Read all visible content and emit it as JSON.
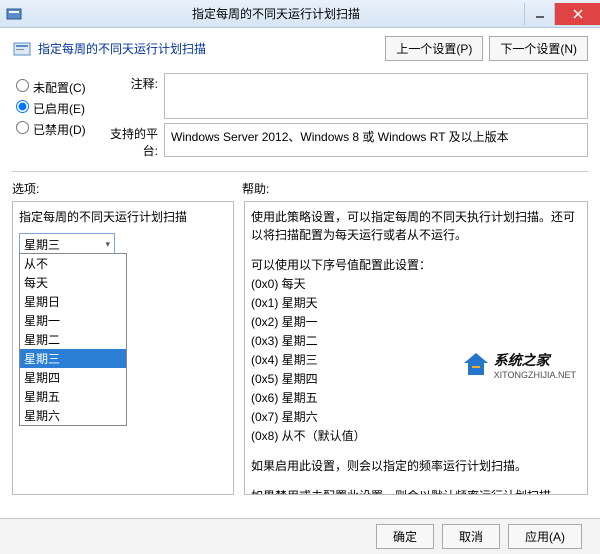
{
  "window": {
    "title": "指定每周的不同天运行计划扫描"
  },
  "header": {
    "text": "指定每周的不同天运行计划扫描",
    "prev": "上一个设置(P)",
    "next": "下一个设置(N)"
  },
  "radios": {
    "unconfigured": "未配置(C)",
    "enabled": "已启用(E)",
    "disabled": "已禁用(D)",
    "selected": "enabled"
  },
  "comment_label": "注释:",
  "comment_value": "",
  "platform_label": "支持的平台:",
  "platform_text": "Windows Server 2012、Windows 8 或 Windows RT 及以上版本",
  "options_label": "选项:",
  "help_label": "帮助:",
  "option_title": "指定每周的不同天运行计划扫描",
  "select": {
    "value": "星期三",
    "items": [
      "从不",
      "每天",
      "星期日",
      "星期一",
      "星期二",
      "星期三",
      "星期四",
      "星期五",
      "星期六"
    ]
  },
  "help": {
    "intro": "使用此策略设置，可以指定每周的不同天执行计划扫描。还可以将扫描配置为每天运行或者从不运行。",
    "codes_intro": "可以使用以下序号值配置此设置：",
    "codes": [
      "(0x0) 每天",
      "(0x1) 星期天",
      "(0x2) 星期一",
      "(0x3) 星期二",
      "(0x4) 星期三",
      "(0x5) 星期四",
      "(0x6) 星期五",
      "(0x7) 星期六",
      "(0x8) 从不（默认值）"
    ],
    "enabled_text": "如果启用此设置，则会以指定的频率运行计划扫描。",
    "disabled_text": "如果禁用或未配置此设置，则会以默认频率运行计划扫描。"
  },
  "footer": {
    "ok": "确定",
    "cancel": "取消",
    "apply": "应用(A)"
  },
  "watermark": {
    "cn": "系统之家",
    "en": "XITONGZHIJIA.NET"
  }
}
